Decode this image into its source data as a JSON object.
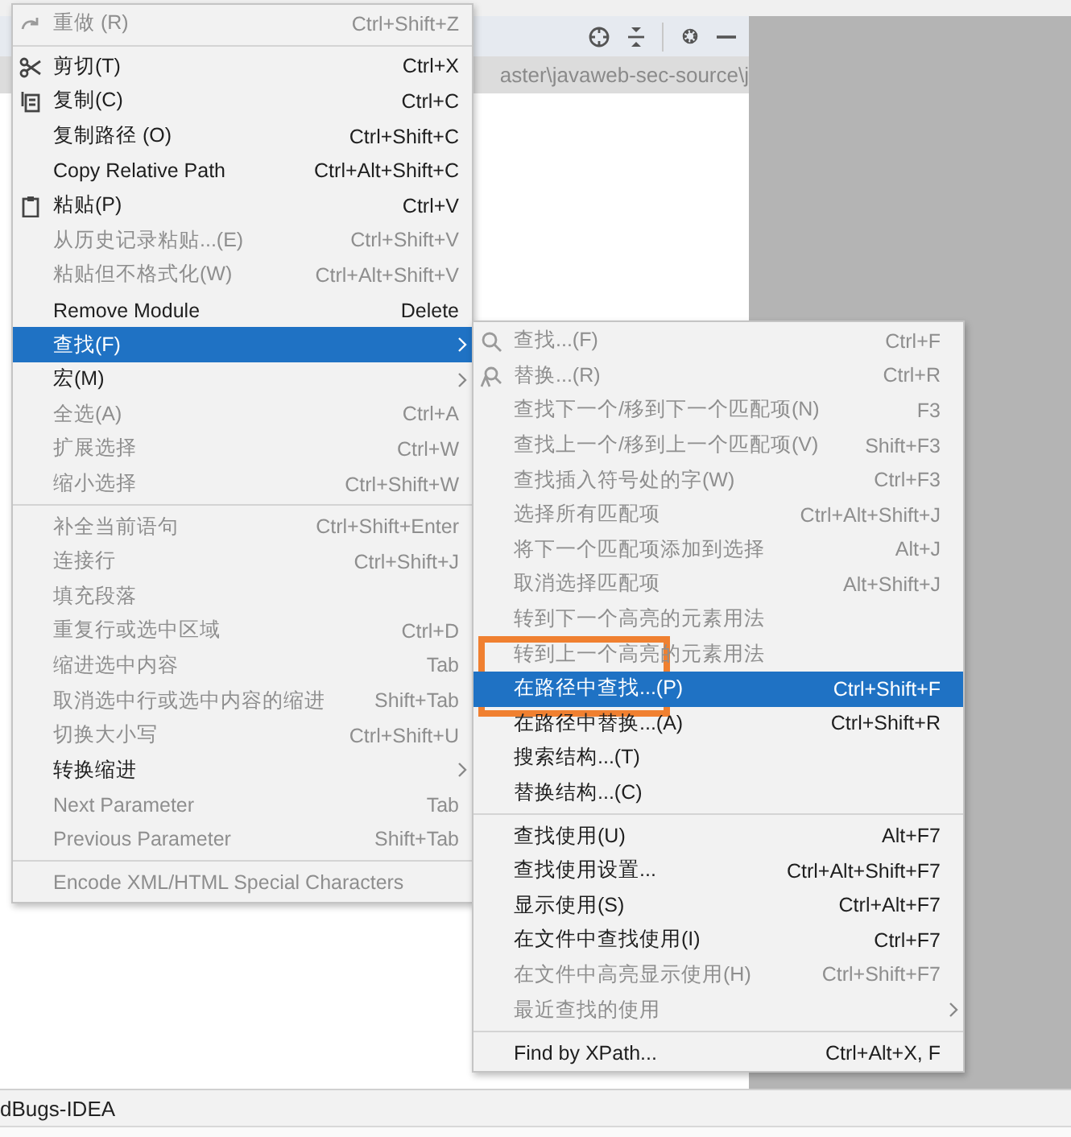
{
  "path_bar": {
    "text": "aster\\javaweb-sec-source\\j"
  },
  "bottom_panel": {
    "title": "dBugs-IDEA"
  },
  "context_menu": {
    "groups": [
      [
        {
          "label": "重做 (R)",
          "shortcut": "Ctrl+Shift+Z",
          "disabled": true,
          "selected": false,
          "has_icon": true
        }
      ],
      [
        {
          "label": "剪切(T)",
          "shortcut": "Ctrl+X",
          "disabled": false,
          "selected": false,
          "has_icon": true
        },
        {
          "label": "复制(C)",
          "shortcut": "Ctrl+C",
          "disabled": false,
          "selected": false,
          "has_icon": true
        },
        {
          "label": "复制路径 (O)",
          "shortcut": "Ctrl+Shift+C",
          "disabled": false,
          "selected": false
        },
        {
          "label": "Copy Relative Path",
          "shortcut": "Ctrl+Alt+Shift+C",
          "disabled": false,
          "selected": false
        },
        {
          "label": "粘贴(P)",
          "shortcut": "Ctrl+V",
          "disabled": false,
          "selected": false,
          "has_icon": true
        },
        {
          "label": "从历史记录粘贴...(E)",
          "shortcut": "Ctrl+Shift+V",
          "disabled": true,
          "selected": false
        },
        {
          "label": "粘贴但不格式化(W)",
          "shortcut": "Ctrl+Alt+Shift+V",
          "disabled": true,
          "selected": false
        },
        {
          "label": "Remove Module",
          "shortcut": "Delete",
          "disabled": false,
          "selected": false
        },
        {
          "label": "查找(F)",
          "disabled": false,
          "selected": true,
          "has_submenu": true
        },
        {
          "label": "宏(M)",
          "disabled": false,
          "selected": false,
          "has_submenu": true
        },
        {
          "label": "全选(A)",
          "shortcut": "Ctrl+A",
          "disabled": true,
          "selected": false
        },
        {
          "label": "扩展选择",
          "shortcut": "Ctrl+W",
          "disabled": true,
          "selected": false
        },
        {
          "label": "缩小选择",
          "shortcut": "Ctrl+Shift+W",
          "disabled": true,
          "selected": false
        }
      ],
      [
        {
          "label": "补全当前语句",
          "shortcut": "Ctrl+Shift+Enter",
          "disabled": true,
          "selected": false
        },
        {
          "label": "连接行",
          "shortcut": "Ctrl+Shift+J",
          "disabled": true,
          "selected": false
        },
        {
          "label": "填充段落",
          "disabled": true,
          "selected": false
        },
        {
          "label": "重复行或选中区域",
          "shortcut": "Ctrl+D",
          "disabled": true,
          "selected": false
        },
        {
          "label": "缩进选中内容",
          "shortcut": "Tab",
          "disabled": true,
          "selected": false
        },
        {
          "label": "取消选中行或选中内容的缩进",
          "shortcut": "Shift+Tab",
          "disabled": true,
          "selected": false
        },
        {
          "label": "切换大小写",
          "shortcut": "Ctrl+Shift+U",
          "disabled": true,
          "selected": false
        },
        {
          "label": "转换缩进",
          "disabled": false,
          "selected": false,
          "has_submenu": true
        },
        {
          "label": "Next Parameter",
          "shortcut": "Tab",
          "disabled": true,
          "selected": false
        },
        {
          "label": "Previous Parameter",
          "shortcut": "Shift+Tab",
          "disabled": true,
          "selected": false
        }
      ],
      [
        {
          "label": "Encode XML/HTML Special Characters",
          "disabled": true,
          "selected": false
        }
      ]
    ]
  },
  "find_submenu": {
    "groups": [
      [
        {
          "label": "查找...(F)",
          "shortcut": "Ctrl+F",
          "disabled": true,
          "selected": false,
          "has_icon": true
        },
        {
          "label": "替换...(R)",
          "shortcut": "Ctrl+R",
          "disabled": true,
          "selected": false,
          "has_icon": true
        },
        {
          "label": "查找下一个/移到下一个匹配项(N)",
          "shortcut": "F3",
          "disabled": true,
          "selected": false
        },
        {
          "label": "查找上一个/移到上一个匹配项(V)",
          "shortcut": "Shift+F3",
          "disabled": true,
          "selected": false
        },
        {
          "label": "查找插入符号处的字(W)",
          "shortcut": "Ctrl+F3",
          "disabled": true,
          "selected": false
        },
        {
          "label": "选择所有匹配项",
          "shortcut": "Ctrl+Alt+Shift+J",
          "disabled": true,
          "selected": false
        },
        {
          "label": "将下一个匹配项添加到选择",
          "shortcut": "Alt+J",
          "disabled": true,
          "selected": false
        },
        {
          "label": "取消选择匹配项",
          "shortcut": "Alt+Shift+J",
          "disabled": true,
          "selected": false
        },
        {
          "label": "转到下一个高亮的元素用法",
          "disabled": true,
          "selected": false
        },
        {
          "label": "转到上一个高亮的元素用法",
          "disabled": true,
          "selected": false
        },
        {
          "label": "在路径中查找...(P)",
          "shortcut": "Ctrl+Shift+F",
          "disabled": false,
          "selected": true
        },
        {
          "label": "在路径中替换...(A)",
          "shortcut": "Ctrl+Shift+R",
          "disabled": false,
          "selected": false
        },
        {
          "label": "搜索结构...(T)",
          "disabled": false,
          "selected": false
        },
        {
          "label": "替换结构...(C)",
          "disabled": false,
          "selected": false
        }
      ],
      [
        {
          "label": "查找使用(U)",
          "shortcut": "Alt+F7",
          "disabled": false,
          "selected": false
        },
        {
          "label": "查找使用设置...",
          "shortcut": "Ctrl+Alt+Shift+F7",
          "disabled": false,
          "selected": false
        },
        {
          "label": "显示使用(S)",
          "shortcut": "Ctrl+Alt+F7",
          "disabled": false,
          "selected": false
        },
        {
          "label": "在文件中查找使用(I)",
          "shortcut": "Ctrl+F7",
          "disabled": false,
          "selected": false
        },
        {
          "label": "在文件中高亮显示使用(H)",
          "shortcut": "Ctrl+Shift+F7",
          "disabled": true,
          "selected": false
        },
        {
          "label": "最近查找的使用",
          "disabled": true,
          "selected": false,
          "has_submenu": true
        }
      ],
      [
        {
          "label": "Find by XPath...",
          "shortcut": "Ctrl+Alt+X, F",
          "disabled": false,
          "selected": false
        }
      ]
    ]
  }
}
